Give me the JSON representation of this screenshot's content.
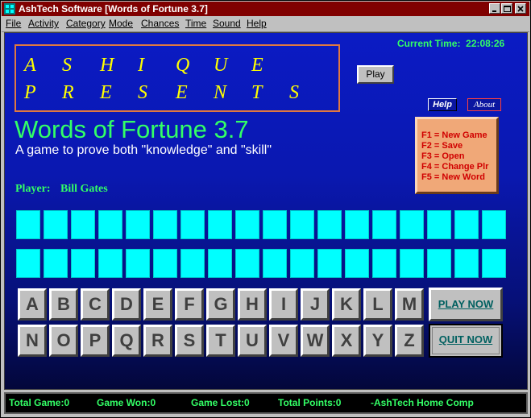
{
  "window": {
    "title": "AshTech Software [Words of Fortune 3.7]"
  },
  "menu": [
    "File",
    "Activity",
    "Category",
    "Mode",
    "Chances",
    "Time",
    "Sound",
    "Help"
  ],
  "clock": {
    "label": "Current Time:",
    "value": "22:08:26"
  },
  "banner": {
    "row1": [
      "A",
      "S",
      "H",
      "I",
      "Q",
      "U",
      "E"
    ],
    "row2": [
      "P",
      "R",
      "E",
      "S",
      "E",
      "N",
      "T",
      "S"
    ]
  },
  "buttons": {
    "play": "Play",
    "help": "Help",
    "about": "About",
    "play_now": "PLAY NOW",
    "quit_now": "QUIT NOW"
  },
  "game": {
    "title": "Words of Fortune 3.7",
    "subtitle": "A game to prove both \"knowledge\" and \"skill\""
  },
  "shortcuts": [
    "F1 = New Game",
    "F2 = Save",
    "F3 = Open",
    "F4 = Change Plr",
    "F5 = New Word"
  ],
  "player": {
    "label": "Player:",
    "name": "Bill Gates"
  },
  "letters_row1": [
    "A",
    "B",
    "C",
    "D",
    "E",
    "F",
    "G",
    "H",
    "I",
    "J",
    "K",
    "L",
    "M"
  ],
  "letters_row2": [
    "N",
    "O",
    "P",
    "Q",
    "R",
    "S",
    "T",
    "U",
    "V",
    "W",
    "X",
    "Y",
    "Z"
  ],
  "status": {
    "total_game": "Total Game:0",
    "game_won": "Game Won:0",
    "game_lost": "Game Lost:0",
    "total_points": "Total Points:0",
    "credit": "-AshTech Home Comp"
  },
  "colors": {
    "title_bar": "#800000",
    "game_bg": "#0b1bc4",
    "accent_green": "#33ff66",
    "banner_text": "#ffff00",
    "slot": "#00ffff"
  }
}
